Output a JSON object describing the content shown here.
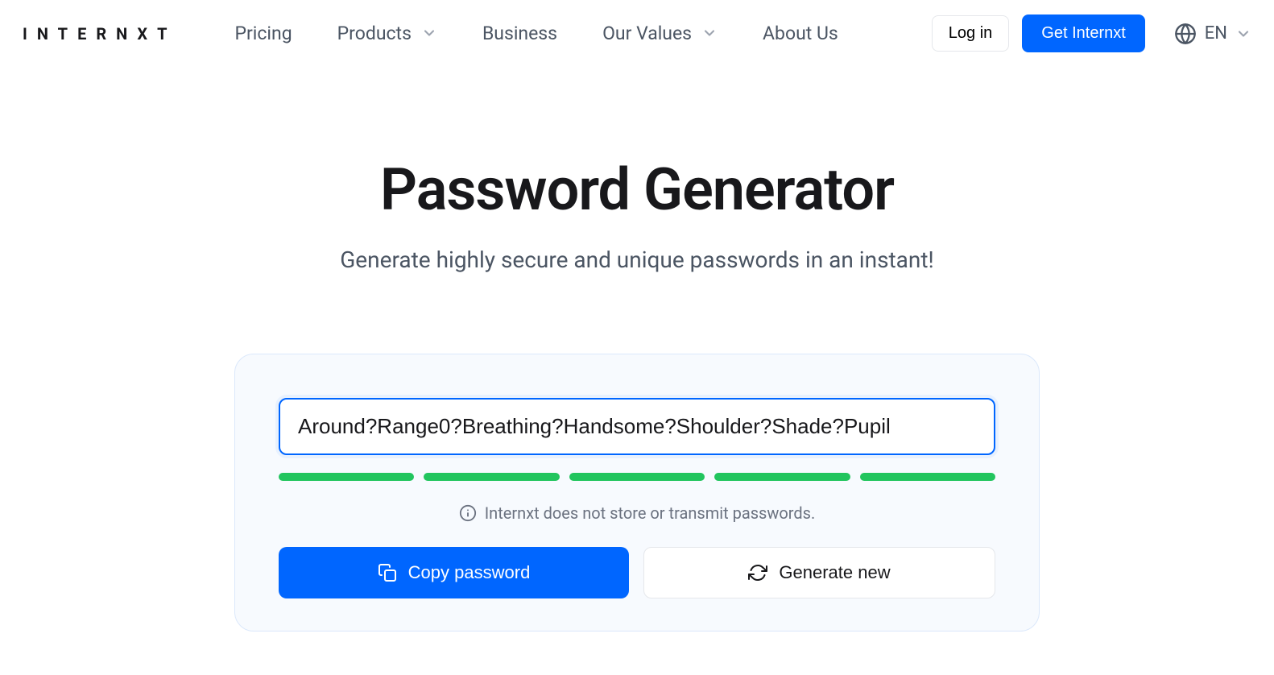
{
  "header": {
    "logo": "INTERNXT",
    "nav": {
      "pricing": "Pricing",
      "products": "Products",
      "business": "Business",
      "our_values": "Our Values",
      "about_us": "About Us"
    },
    "login_label": "Log in",
    "cta_label": "Get Internxt",
    "lang": "EN"
  },
  "main": {
    "title": "Password Generator",
    "subtitle": "Generate highly secure and unique passwords in an instant!"
  },
  "card": {
    "password_value": "Around?Range0?Breathing?Handsome?Shoulder?Shade?Pupil",
    "disclaimer": "Internxt does not store or transmit passwords.",
    "copy_label": "Copy password",
    "generate_label": "Generate new",
    "strength_color": "#22c55e"
  }
}
